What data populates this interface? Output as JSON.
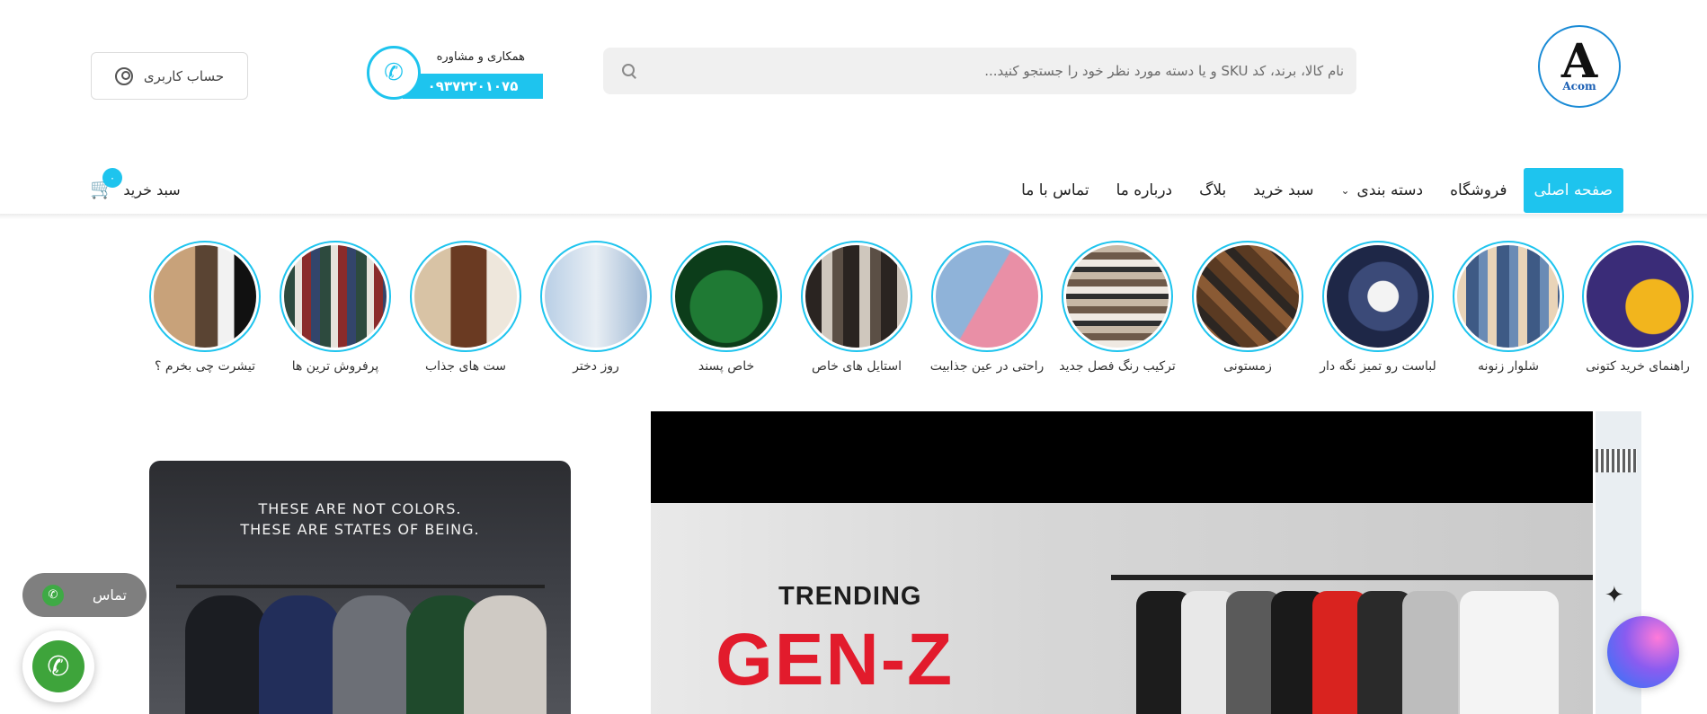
{
  "logo": {
    "letter": "A",
    "text": "Acom"
  },
  "search": {
    "placeholder": "نام کالا، برند، کد SKU و یا دسته مورد نظر خود را جستجو کنید..."
  },
  "consult": {
    "label": "همکاری و مشاوره",
    "phone": "۰۹۳۷۲۲۰۱۰۷۵"
  },
  "account": {
    "label": "حساب کاربری"
  },
  "nav": {
    "items": [
      {
        "label": "صفحه اصلی",
        "active": true
      },
      {
        "label": "فروشگاه"
      },
      {
        "label": "دسته بندی",
        "has_dropdown": true
      },
      {
        "label": "سبد خرید"
      },
      {
        "label": "بلاگ"
      },
      {
        "label": "درباره ما"
      },
      {
        "label": "تماس با ما"
      }
    ]
  },
  "cart": {
    "label": "سبد خرید",
    "count": "۰"
  },
  "stories": [
    {
      "label": "راهنمای خرید کتونی"
    },
    {
      "label": "شلوار زنونه"
    },
    {
      "label": "لباست رو تمیز نگه دار"
    },
    {
      "label": "زمستونی"
    },
    {
      "label": "ترکیب رنگ فصل جدید"
    },
    {
      "label": "راحتی در عین جذابیت"
    },
    {
      "label": "استایل های خاص"
    },
    {
      "label": "خاص پسند"
    },
    {
      "label": "روز دختر"
    },
    {
      "label": "ست های جذاب"
    },
    {
      "label": "پرفروش ترین ها"
    },
    {
      "label": "تیشرت چی بخرم ؟"
    }
  ],
  "banner_left": {
    "caption_line1": "THESE ARE NOT COLORS.",
    "caption_line2": "THESE ARE STATES OF BEING."
  },
  "banner_main": {
    "line1": "TRENDING",
    "line2": "GEN-Z"
  },
  "floating": {
    "contact_label": "تماس"
  },
  "colors": {
    "accent": "#1ec4ee",
    "whatsapp": "#3eaa45",
    "call": "#3ea43b"
  }
}
